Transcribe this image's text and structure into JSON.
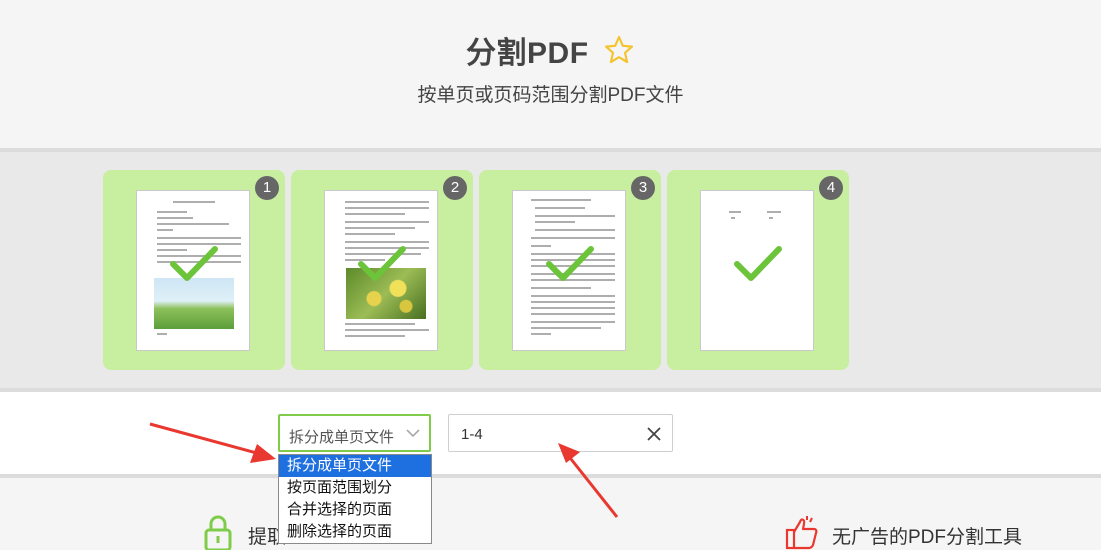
{
  "header": {
    "title": "分割PDF",
    "subtitle": "按单页或页码范围分割PDF文件",
    "favorite_icon": "star-outline-icon"
  },
  "pages": [
    {
      "number": "1",
      "selected": true
    },
    {
      "number": "2",
      "selected": true
    },
    {
      "number": "3",
      "selected": true
    },
    {
      "number": "4",
      "selected": true
    }
  ],
  "controls": {
    "mode_select": {
      "value": "拆分成单页文件",
      "options": [
        "拆分成单页文件",
        "按页面范围划分",
        "合并选择的页面",
        "删除选择的页面"
      ],
      "highlighted_index": 0
    },
    "range_input": {
      "value": "1-4"
    }
  },
  "features": {
    "left_label": "提取",
    "right_label": "无广告的PDF分割工具"
  },
  "colors": {
    "accent_green": "#7fcc4a",
    "card_green": "#c8eea0",
    "check_green": "#6cc43a",
    "star_yellow": "#f4c430",
    "annotation_red": "#e8382f",
    "dropdown_highlight": "#1e6fe0"
  }
}
